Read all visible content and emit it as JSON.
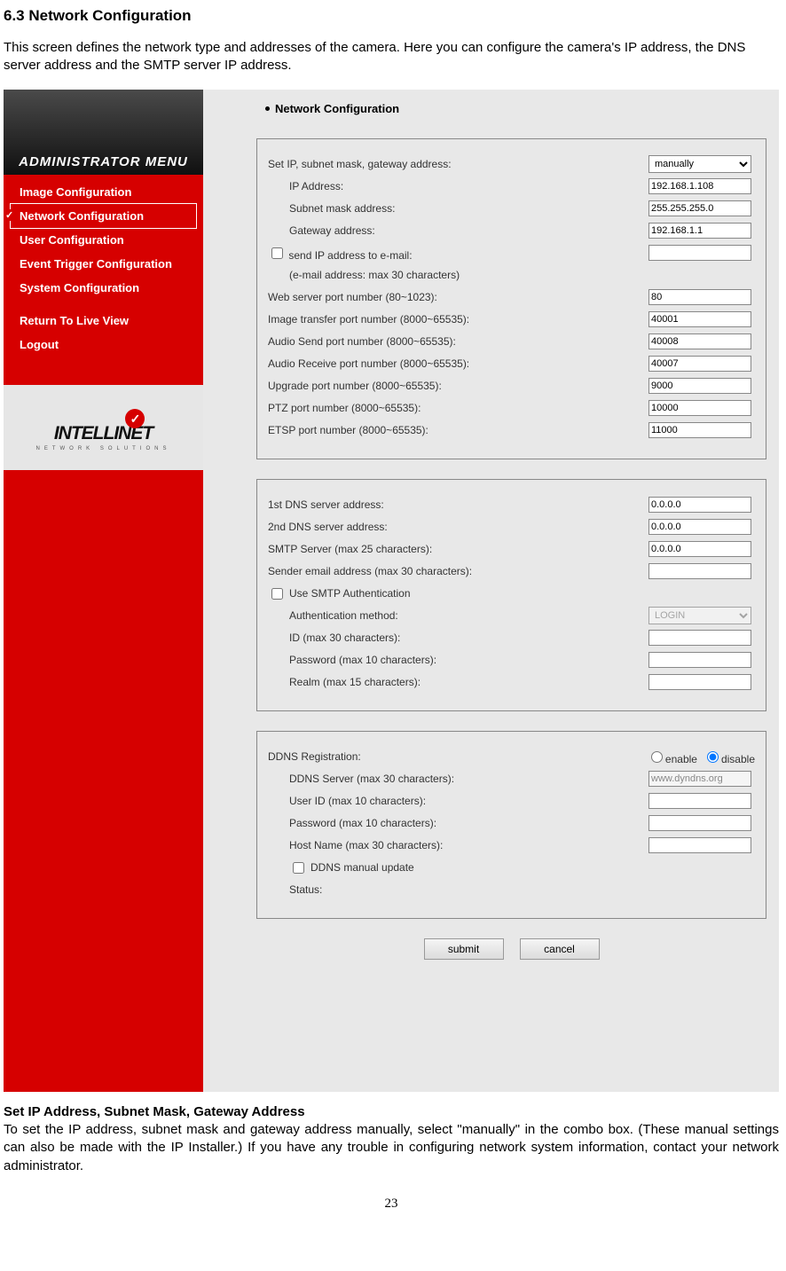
{
  "page": {
    "section_title": "6.3 Network Configuration",
    "intro": "This screen defines the network type and addresses of the camera. Here you can configure the camera's IP address, the DNS server address and the SMTP server IP address.",
    "footer_heading": "Set IP Address, Subnet Mask, Gateway Address",
    "footer_para": "To set the IP address, subnet mask and gateway address manually, select \"manually\" in the combo box. (These manual settings can also be made with the IP Installer.) If you have any trouble in configuring network system information, contact your network administrator.",
    "page_number": "23"
  },
  "sidebar": {
    "banner": "ADMINISTRATOR MENU",
    "items": [
      "Image Configuration",
      "Network Configuration",
      "User Configuration",
      "Event Trigger Configuration",
      "System Configuration"
    ],
    "return_label": "Return To Live View",
    "logout_label": "Logout",
    "brand_name": "INTELLINET",
    "brand_sub": "NETWORK SOLUTIONS"
  },
  "main": {
    "title": "Network Configuration",
    "panel1": {
      "set_ip_label": "Set IP, subnet mask, gateway address:",
      "set_ip_mode": "manually",
      "ip_label": "IP Address:",
      "ip_value": "192.168.1.108",
      "subnet_label": "Subnet mask address:",
      "subnet_value": "255.255.255.0",
      "gateway_label": "Gateway address:",
      "gateway_value": "192.168.1.1",
      "send_ip_label": "send IP address to e-mail:",
      "send_ip_hint": "(e-mail address: max 30 characters)",
      "send_ip_value": "",
      "web_port_label": "Web server port number (80~1023):",
      "web_port_value": "80",
      "img_port_label": "Image transfer port number (8000~65535):",
      "img_port_value": "40001",
      "audio_send_label": "Audio Send port number (8000~65535):",
      "audio_send_value": "40008",
      "audio_recv_label": "Audio Receive port number (8000~65535):",
      "audio_recv_value": "40007",
      "upgrade_label": "Upgrade port number (8000~65535):",
      "upgrade_value": "9000",
      "ptz_label": "PTZ port number (8000~65535):",
      "ptz_value": "10000",
      "etsp_label": "ETSP port number (8000~65535):",
      "etsp_value": "11000"
    },
    "panel2": {
      "dns1_label": "1st DNS server address:",
      "dns1_value": "0.0.0.0",
      "dns2_label": "2nd DNS server address:",
      "dns2_value": "0.0.0.0",
      "smtp_label": "SMTP Server (max 25 characters):",
      "smtp_value": "0.0.0.0",
      "sender_label": "Sender email address (max 30 characters):",
      "sender_value": "",
      "smtp_auth_label": "Use SMTP Authentication",
      "auth_method_label": "Authentication method:",
      "auth_method_value": "LOGIN",
      "id_label": "ID (max 30 characters):",
      "id_value": "",
      "pw_label": "Password (max 10 characters):",
      "pw_value": "",
      "realm_label": "Realm (max 15 characters):",
      "realm_value": ""
    },
    "panel3": {
      "ddns_reg_label": "DDNS Registration:",
      "enable_label": "enable",
      "disable_label": "disable",
      "ddns_server_label": "DDNS Server (max 30 characters):",
      "ddns_server_value": "www.dyndns.org",
      "user_id_label": "User ID (max 10 characters):",
      "user_id_value": "",
      "password_label": "Password (max 10 characters):",
      "password_value": "",
      "host_label": "Host Name (max 30 characters):",
      "host_value": "",
      "manual_update_label": "DDNS manual update",
      "status_label": "Status:"
    },
    "buttons": {
      "submit": "submit",
      "cancel": "cancel"
    }
  }
}
